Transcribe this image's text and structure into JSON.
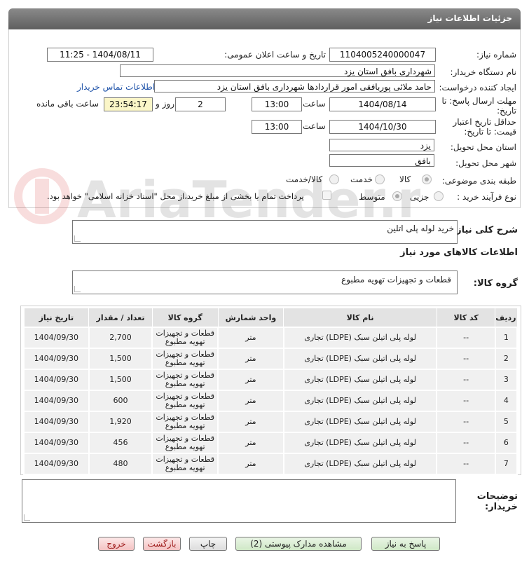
{
  "header": {
    "title": "جزئیات اطلاعات نیاز"
  },
  "form": {
    "need_number_label": "شماره نیاز:",
    "need_number": "1104005240000047",
    "announce_label": "تاریخ و ساعت اعلان عمومی:",
    "announce_value": "1404/08/11 - 11:25",
    "buyer_org_label": "نام دستگاه خریدار:",
    "buyer_org": "شهرداری بافق استان یزد",
    "creator_label": "ایجاد کننده درخواست:",
    "creator": "حامد ملائی پوربافقی امور قراردادها شهرداری بافق استان یزد",
    "contact_link": "اطلاعات تماس خریدار",
    "deadline_label_1": "مهلت ارسال پاسخ: تا",
    "deadline_label_2": "تاریخ:",
    "deadline_date": "1404/08/14",
    "time_label": "ساعت",
    "deadline_time": "13:00",
    "days_value": "2",
    "days_label": "روز و",
    "remaining_time": "23:54:17",
    "remaining_label": "ساعت باقی مانده",
    "validity_label_1": "حداقل تاریخ اعتبار",
    "validity_label_2": "قیمت: تا تاریخ:",
    "validity_date": "1404/10/30",
    "validity_time": "13:00",
    "province_label": "استان محل تحویل:",
    "province": "یزد",
    "city_label": "شهر محل تحویل:",
    "city": "بافق",
    "category_label": "طبقه بندی موضوعی:",
    "category_options": [
      "کالا",
      "خدمت",
      "کالا/خدمت"
    ],
    "process_label": "نوع فرآیند خرید :",
    "process_options": [
      "جزیی",
      "متوسط"
    ],
    "payment_note": "پرداخت تمام یا بخشی از مبلغ خرید،از محل \"اسناد خزانه اسلامی\" خواهد بود."
  },
  "description": {
    "label": "شرح کلی نیاز:",
    "value": "خرید لوله پلی اتلین"
  },
  "goods_section_title": "اطلاعات کالاهای مورد نیاز",
  "goods_group": {
    "label": "گروه کالا:",
    "value": "قطعات و تجهیزات تهویه مطبوع"
  },
  "table": {
    "headers": [
      "ردیف",
      "کد کالا",
      "نام کالا",
      "واحد شمارش",
      "گروه کالا",
      "تعداد / مقدار",
      "تاریخ نیاز"
    ],
    "rows": [
      [
        "1",
        "--",
        "لوله پلی اتیلن سبک (LDPE) تجاری",
        "متر",
        "قطعات و تجهیزات تهویه مطبوع",
        "2,700",
        "1404/09/30"
      ],
      [
        "2",
        "--",
        "لوله پلی اتیلن سبک (LDPE) تجاری",
        "متر",
        "قطعات و تجهیزات تهویه مطبوع",
        "1,500",
        "1404/09/30"
      ],
      [
        "3",
        "--",
        "لوله پلی اتیلن سبک (LDPE) تجاری",
        "متر",
        "قطعات و تجهیزات تهویه مطبوع",
        "1,500",
        "1404/09/30"
      ],
      [
        "4",
        "--",
        "لوله پلی اتیلن سبک (LDPE) تجاری",
        "متر",
        "قطعات و تجهیزات تهویه مطبوع",
        "600",
        "1404/09/30"
      ],
      [
        "5",
        "--",
        "لوله پلی اتیلن سبک (LDPE) تجاری",
        "متر",
        "قطعات و تجهیزات تهویه مطبوع",
        "1,920",
        "1404/09/30"
      ],
      [
        "6",
        "--",
        "لوله پلی اتیلن سبک (LDPE) تجاری",
        "متر",
        "قطعات و تجهیزات تهویه مطبوع",
        "456",
        "1404/09/30"
      ],
      [
        "7",
        "--",
        "لوله پلی اتیلن سبک (LDPE) تجاری",
        "متر",
        "قطعات و تجهیزات تهویه مطبوع",
        "480",
        "1404/09/30"
      ]
    ]
  },
  "buyer_notes": {
    "label_1": "توضیحات",
    "label_2": "خریدار:"
  },
  "buttons": {
    "reply": "پاسخ به نیاز",
    "attachments": "مشاهده مدارک پیوستی (2)",
    "print": "چاپ",
    "back": "بازگشت",
    "exit": "خروج"
  },
  "watermark": "AriaTender.net"
}
